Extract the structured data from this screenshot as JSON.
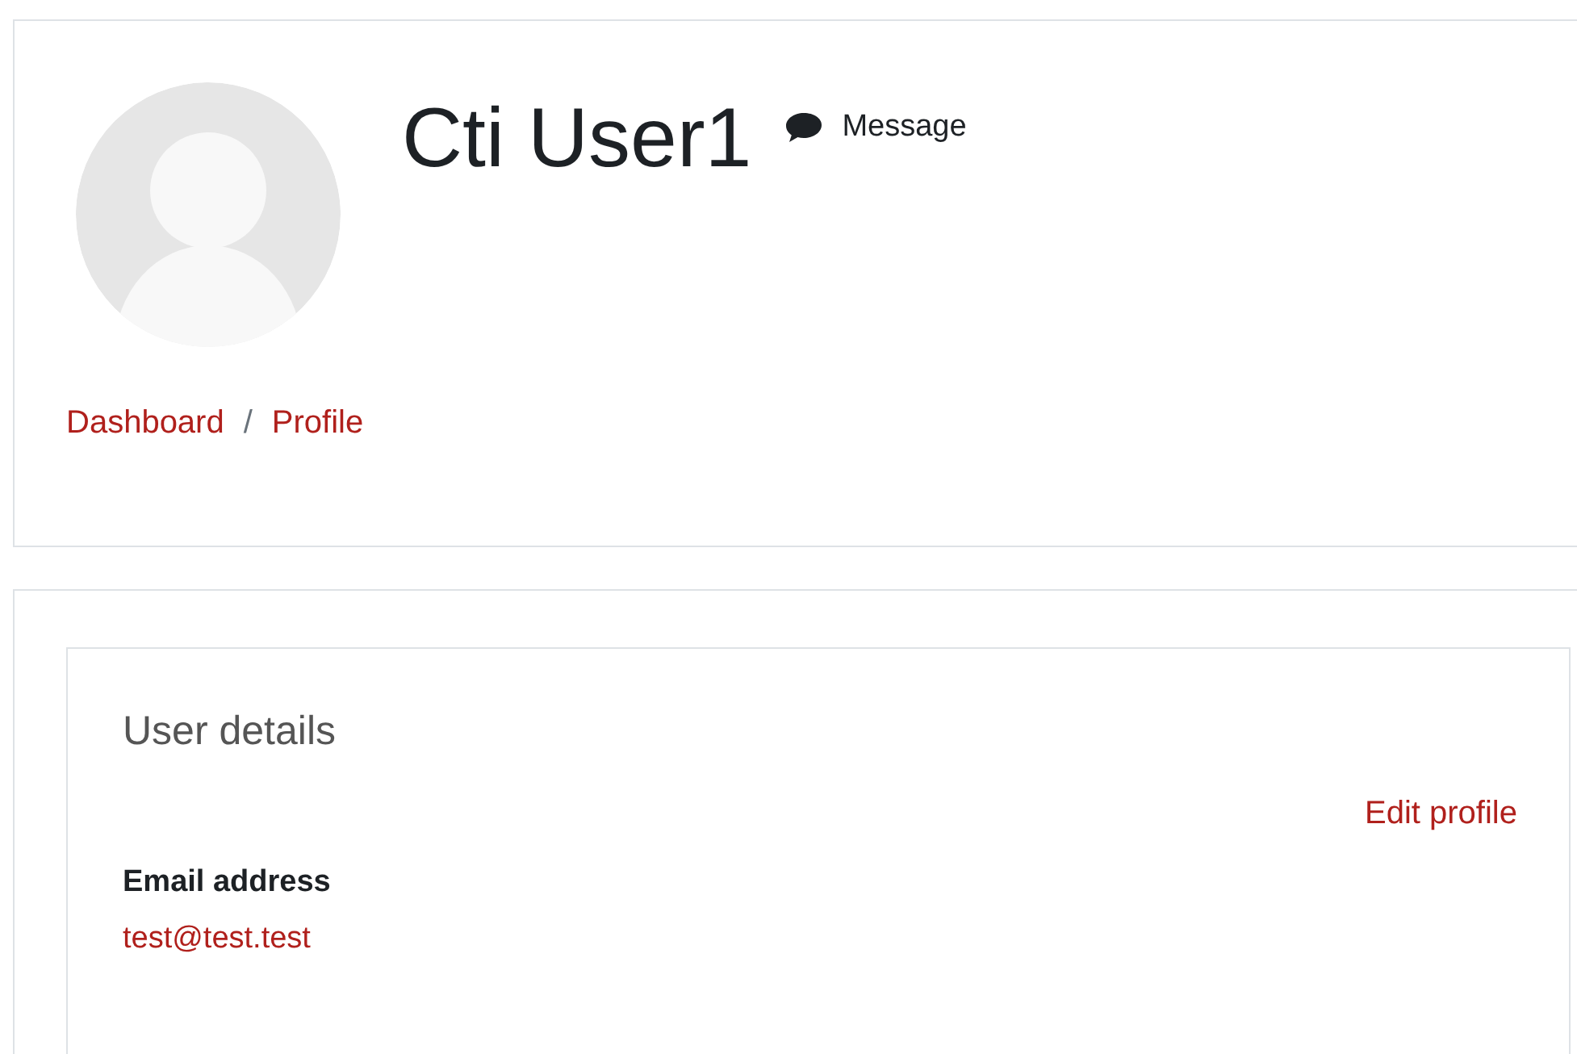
{
  "header": {
    "name": "Cti User1",
    "message_link": "Message",
    "breadcrumb": [
      "Dashboard",
      "Profile"
    ],
    "breadcrumb_separator": "/"
  },
  "user_details": {
    "title": "User details",
    "edit_link": "Edit profile",
    "fields": [
      {
        "label": "Email address",
        "value": "test@test.test"
      }
    ]
  }
}
